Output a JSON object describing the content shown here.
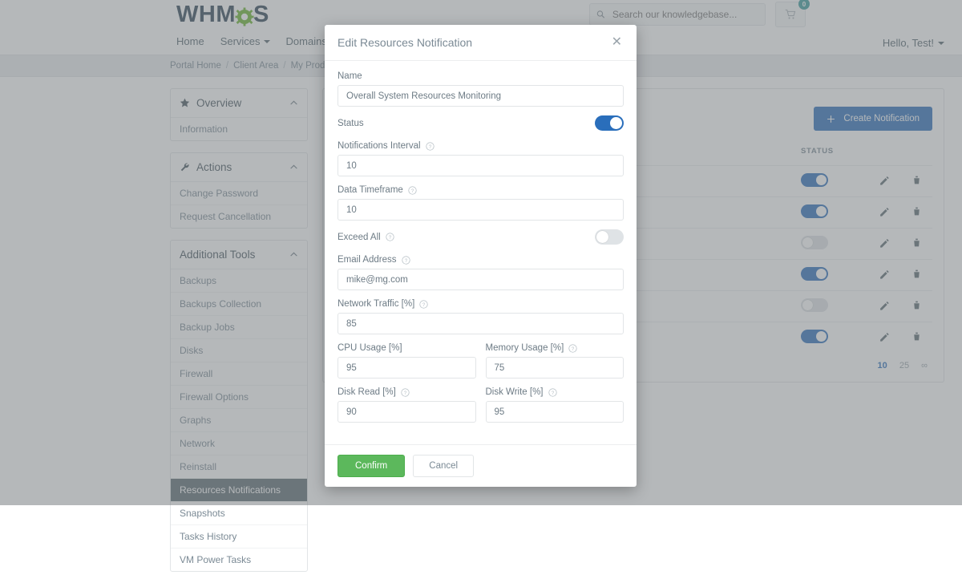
{
  "header": {
    "logo_text_1": "WHM",
    "logo_text_2": "S",
    "nav": [
      {
        "label": "Home",
        "has_caret": false
      },
      {
        "label": "Services",
        "has_caret": true
      },
      {
        "label": "Domains",
        "has_caret": true
      }
    ],
    "search_placeholder": "Search our knowledgebase...",
    "cart_count": "0",
    "account_label": "Hello, Test!"
  },
  "breadcrumb": {
    "items": [
      "Portal Home",
      "Client Area",
      "My Products"
    ],
    "separator": "/"
  },
  "sidebar": {
    "groups": [
      {
        "title": "Overview",
        "icon": "star-icon",
        "collapse_icon": "chevron-up-icon",
        "items": [
          {
            "label": "Information",
            "active": false
          }
        ]
      },
      {
        "title": "Actions",
        "icon": "wrench-icon",
        "collapse_icon": "chevron-up-icon",
        "items": [
          {
            "label": "Change Password",
            "active": false
          },
          {
            "label": "Request Cancellation",
            "active": false
          }
        ]
      },
      {
        "title": "Additional Tools",
        "icon": "none",
        "collapse_icon": "chevron-up-icon",
        "items": [
          {
            "label": "Backups",
            "active": false
          },
          {
            "label": "Backups Collection",
            "active": false
          },
          {
            "label": "Backup Jobs",
            "active": false
          },
          {
            "label": "Disks",
            "active": false
          },
          {
            "label": "Firewall",
            "active": false
          },
          {
            "label": "Firewall Options",
            "active": false
          },
          {
            "label": "Graphs",
            "active": false
          },
          {
            "label": "Network",
            "active": false
          },
          {
            "label": "Reinstall",
            "active": false
          },
          {
            "label": "Resources Notifications",
            "active": true
          },
          {
            "label": "Snapshots",
            "active": false
          },
          {
            "label": "Tasks History",
            "active": false
          },
          {
            "label": "VM Power Tasks",
            "active": false
          }
        ]
      }
    ]
  },
  "main": {
    "create_button": "Create Notification",
    "create_icon": "plus-icon",
    "table": {
      "columns": [
        "STATUS",
        "",
        ""
      ],
      "rows": [
        {
          "status": true,
          "edit_icon": "pencil-icon",
          "delete_icon": "trash-icon"
        },
        {
          "status": true,
          "edit_icon": "pencil-icon",
          "delete_icon": "trash-icon"
        },
        {
          "status": false,
          "edit_icon": "pencil-icon",
          "delete_icon": "trash-icon"
        },
        {
          "status": true,
          "edit_icon": "pencil-icon",
          "delete_icon": "trash-icon"
        },
        {
          "status": false,
          "edit_icon": "pencil-icon",
          "delete_icon": "trash-icon"
        },
        {
          "status": true,
          "edit_icon": "pencil-icon",
          "delete_icon": "trash-icon"
        }
      ]
    },
    "pagination": [
      "10",
      "25",
      "∞"
    ]
  },
  "modal": {
    "title": "Edit Resources Notification",
    "close_icon": "close-icon",
    "help_icon": "question-circle-icon",
    "fields": {
      "name": {
        "label": "Name",
        "value": "Overall System Resources Monitoring",
        "help": false
      },
      "status": {
        "label": "Status",
        "value": true,
        "help": false
      },
      "notifications_interval": {
        "label": "Notifications Interval",
        "value": "10",
        "help": true
      },
      "data_timeframe": {
        "label": "Data Timeframe",
        "value": "10",
        "help": true
      },
      "exceed_all": {
        "label": "Exceed All",
        "value": false,
        "help": true
      },
      "email_address": {
        "label": "Email Address",
        "value": "mike@mg.com",
        "help": true
      },
      "network_traffic": {
        "label": "Network Traffic [%]",
        "value": "85",
        "help": true
      },
      "cpu_usage": {
        "label": "CPU Usage [%]",
        "value": "95",
        "help": false
      },
      "memory_usage": {
        "label": "Memory Usage [%]",
        "value": "75",
        "help": true
      },
      "disk_read": {
        "label": "Disk Read [%]",
        "value": "90",
        "help": true
      },
      "disk_write": {
        "label": "Disk Write [%]",
        "value": "95",
        "help": true
      }
    },
    "confirm_label": "Confirm",
    "cancel_label": "Cancel"
  },
  "colors": {
    "primary_blue": "#2a6ebb",
    "confirm_green": "#5cb85c",
    "logo_navy": "#2d4456",
    "logo_gear_green": "#69b42d",
    "cart_badge_teal": "#3a9c9c",
    "active_sidebar": "#5c6a72"
  }
}
